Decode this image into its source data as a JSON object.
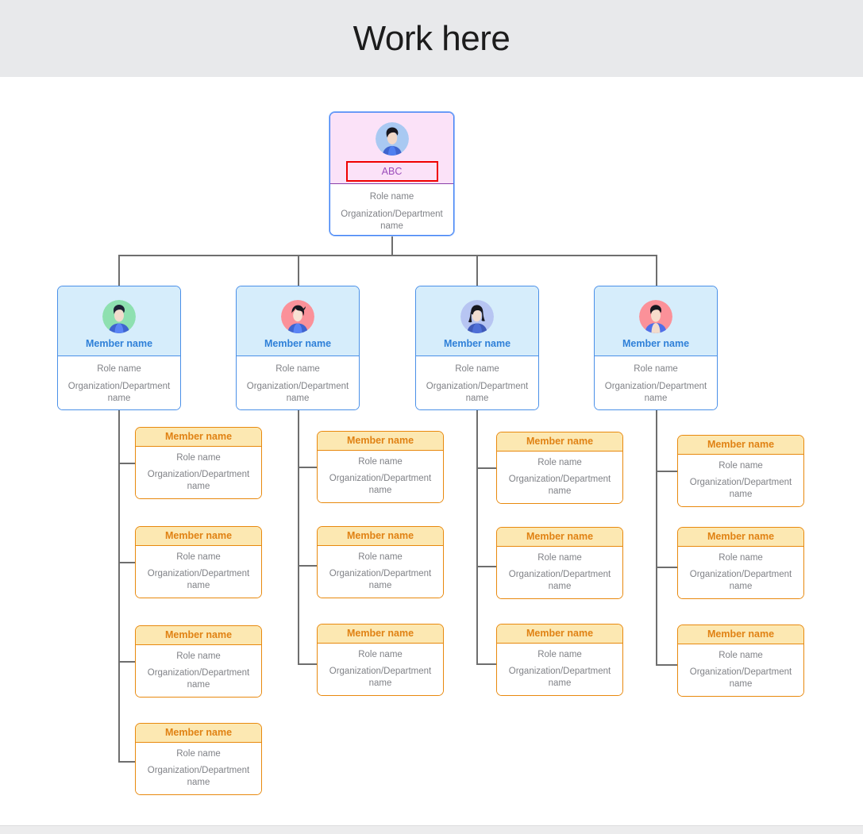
{
  "header": {
    "title": "Work here"
  },
  "colors": {
    "header_bar": "#e8e9eb",
    "canvas": "#ffffff",
    "root_header_fill": "#fbe2f8",
    "root_border": "#3d7ff5",
    "root_name_text": "#9b4dbb",
    "selection_border": "#ef0000",
    "level2_header_fill": "#d6edfb",
    "level2_border": "#4a90e8",
    "level2_name_text": "#2f80d8",
    "leaf_header_fill": "#fce8b2",
    "leaf_border": "#e8890e",
    "leaf_name_text": "#e08214",
    "body_text": "#808287",
    "connector_line": "#6e6e6e"
  },
  "chart_data": {
    "type": "diagram",
    "diagram_type": "org-chart",
    "title": "Work here",
    "root": {
      "name": "ABC",
      "role": "Role name",
      "org": "Organization/Department name",
      "avatar_icon": "person-avatar-icon",
      "avatar_bg": "#a9c9f2",
      "selected": true
    },
    "level2": [
      {
        "name": "Member name",
        "role": "Role name",
        "org": "Organization/Department name",
        "avatar_icon": "person-avatar-icon",
        "avatar_bg": "#8ee0b0",
        "avatar_variant": "short-hair-male",
        "children_count": 4
      },
      {
        "name": "Member name",
        "role": "Role name",
        "org": "Organization/Department name",
        "avatar_icon": "person-avatar-icon",
        "avatar_bg": "#fb9199",
        "avatar_variant": "bob-hair-female",
        "children_count": 3
      },
      {
        "name": "Member name",
        "role": "Role name",
        "org": "Organization/Department name",
        "avatar_icon": "person-avatar-icon",
        "avatar_bg": "#b7c5f2",
        "avatar_variant": "long-hair-female",
        "children_count": 3
      },
      {
        "name": "Member name",
        "role": "Role name",
        "org": "Organization/Department name",
        "avatar_icon": "person-avatar-icon",
        "avatar_bg": "#fb9199",
        "avatar_variant": "short-hair-male",
        "children_count": 3
      }
    ],
    "leaf_defaults": {
      "name": "Member name",
      "role": "Role name",
      "org": "Organization/Department name"
    },
    "leaves": {
      "column_1": [
        {
          "name": "Member name",
          "role": "Role name",
          "org": "Organization/Department name"
        },
        {
          "name": "Member name",
          "role": "Role name",
          "org": "Organization/Department name"
        },
        {
          "name": "Member name",
          "role": "Role name",
          "org": "Organization/Department name"
        },
        {
          "name": "Member name",
          "role": "Role name",
          "org": "Organization/Department name"
        }
      ],
      "column_2": [
        {
          "name": "Member name",
          "role": "Role name",
          "org": "Organization/Department name"
        },
        {
          "name": "Member name",
          "role": "Role name",
          "org": "Organization/Department name"
        },
        {
          "name": "Member name",
          "role": "Role name",
          "org": "Organization/Department name"
        }
      ],
      "column_3": [
        {
          "name": "Member name",
          "role": "Role name",
          "org": "Organization/Department name"
        },
        {
          "name": "Member name",
          "role": "Role name",
          "org": "Organization/Department name"
        },
        {
          "name": "Member name",
          "role": "Role name",
          "org": "Organization/Department name"
        }
      ],
      "column_4": [
        {
          "name": "Member name",
          "role": "Role name",
          "org": "Organization/Department name"
        },
        {
          "name": "Member name",
          "role": "Role name",
          "org": "Organization/Department name"
        },
        {
          "name": "Member name",
          "role": "Role name",
          "org": "Organization/Department name"
        }
      ]
    },
    "total_nodes": 18,
    "depth": 3
  }
}
